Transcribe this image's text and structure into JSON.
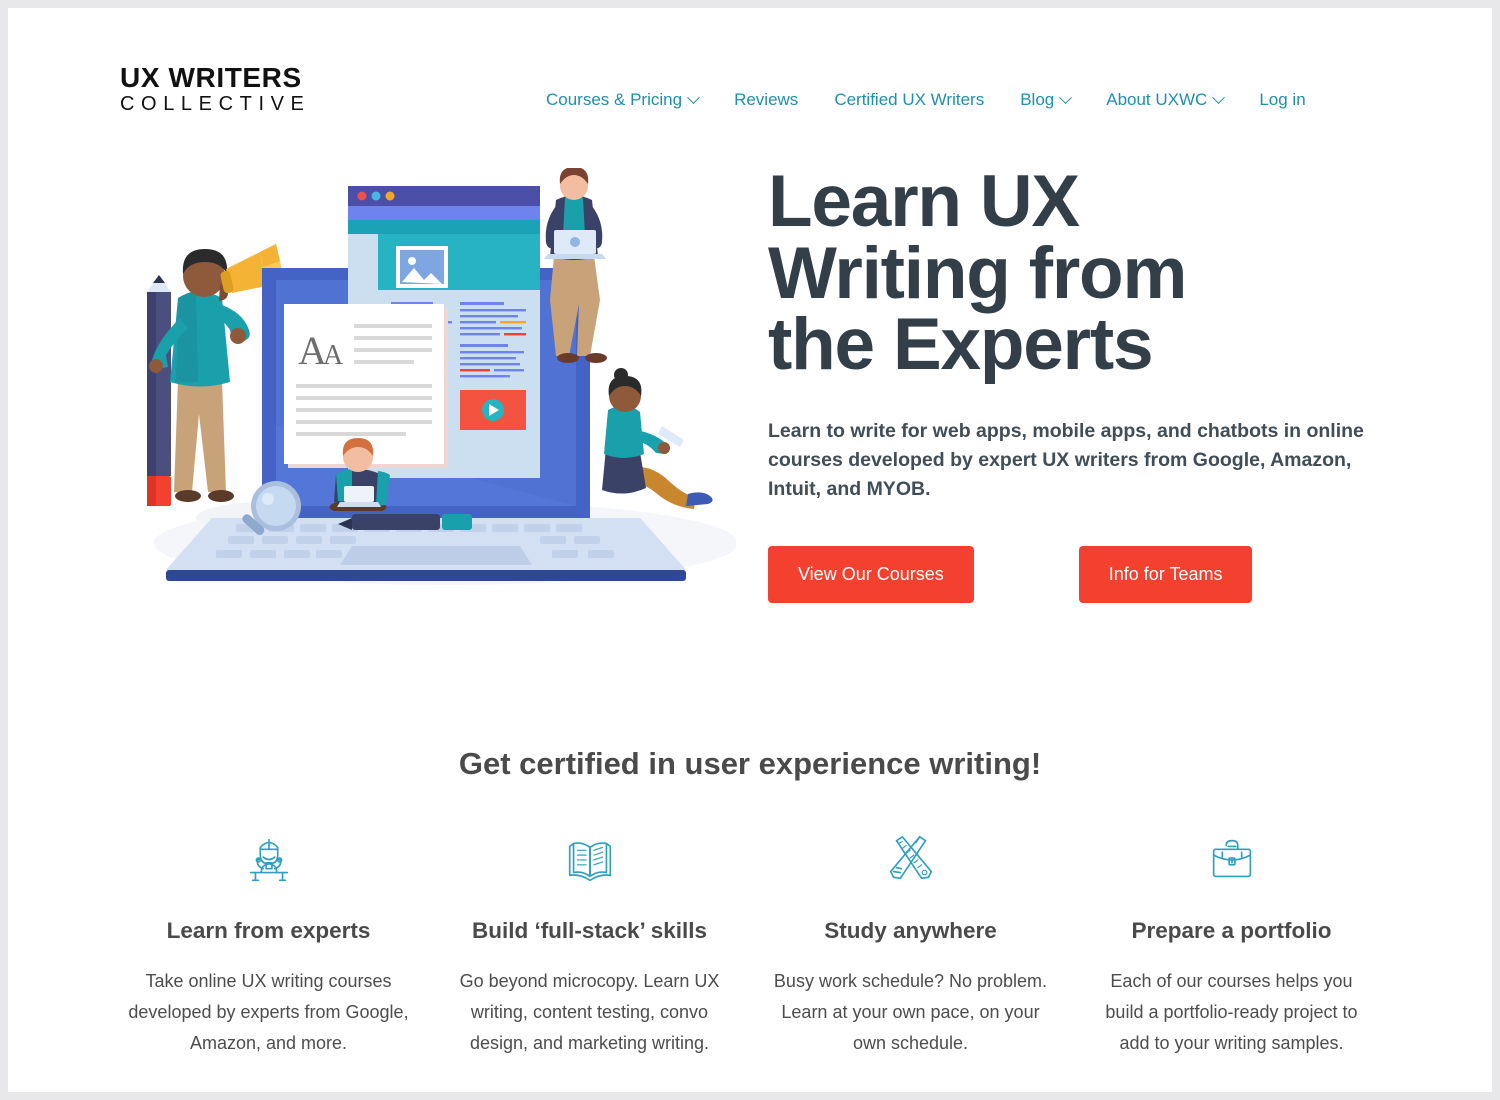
{
  "brand": {
    "logo_line1": "UX WRITERS",
    "logo_line2": "COLLECTIVE",
    "accent_teal": "#1f8fae",
    "accent_red": "#f4402f",
    "heading_dark": "#333f48",
    "body_gray": "#4d4d4d"
  },
  "nav": {
    "items": [
      {
        "label": "Courses & Pricing",
        "has_dropdown": true,
        "icon": "chevron-down-icon"
      },
      {
        "label": "Reviews",
        "has_dropdown": false,
        "icon": ""
      },
      {
        "label": "Certified UX Writers",
        "has_dropdown": false,
        "icon": ""
      },
      {
        "label": "Blog",
        "has_dropdown": true,
        "icon": "chevron-down-icon"
      },
      {
        "label": "About UXWC",
        "has_dropdown": true,
        "icon": "chevron-down-icon"
      },
      {
        "label": "Log in",
        "has_dropdown": false,
        "icon": ""
      }
    ]
  },
  "hero": {
    "title": "Learn UX Writing from the Experts",
    "subtitle": "Learn to write for web apps, mobile apps, and chatbots in online courses developed by expert UX writers from Google, Amazon, Intuit, and MYOB.",
    "primary_button": "View Our Courses",
    "secondary_button": "Info for Teams",
    "illustration": "people-learning-ux-writing-laptop-illustration"
  },
  "features": {
    "heading": "Get certified in user experience writing!",
    "cards": [
      {
        "icon": "instructor-at-desk-icon",
        "title": "Learn from experts",
        "text": "Take online UX writing courses developed by experts from Google, Amazon, and more."
      },
      {
        "icon": "open-book-icon",
        "title": "Build ‘full-stack’ skills",
        "text": "Go beyond microcopy. Learn UX writing, content testing, convo design, and marketing writing."
      },
      {
        "icon": "ruler-and-pencil-icon",
        "title": "Study anywhere",
        "text": "Busy work schedule? No problem. Learn at your own pace, on your own schedule."
      },
      {
        "icon": "briefcase-icon",
        "title": "Prepare a portfolio",
        "text": "Each of our courses helps you build a portfolio-ready project to add to your writing samples."
      }
    ]
  }
}
